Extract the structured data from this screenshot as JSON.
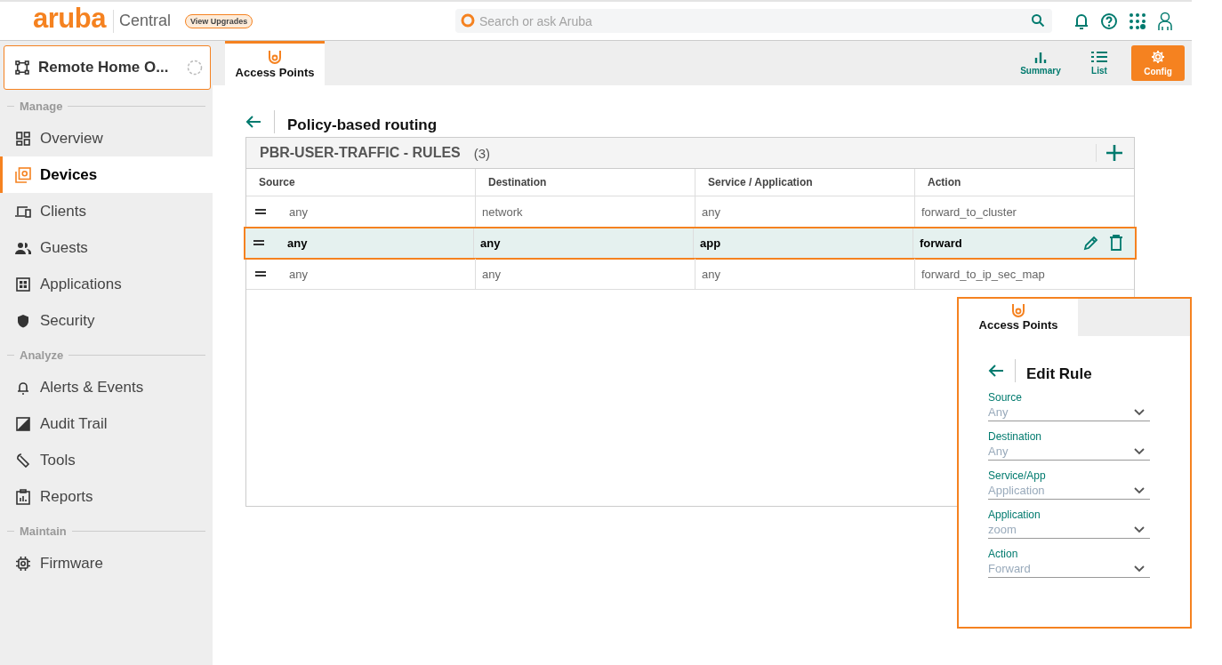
{
  "header": {
    "logo": "aruba",
    "product": "Central",
    "upgrade_badge": "View Upgrades",
    "search": {
      "placeholder": "Search or ask Aruba"
    }
  },
  "site_selector": {
    "label": "Remote Home O..."
  },
  "sidebar": [
    {
      "heading": "Manage",
      "items": [
        {
          "label": "Overview",
          "selected": false
        },
        {
          "label": "Devices",
          "selected": true
        },
        {
          "label": "Clients",
          "selected": false
        },
        {
          "label": "Guests",
          "selected": false
        },
        {
          "label": "Applications",
          "selected": false
        },
        {
          "label": "Security",
          "selected": false
        }
      ]
    },
    {
      "heading": "Analyze",
      "items": [
        {
          "label": "Alerts & Events",
          "selected": false
        },
        {
          "label": "Audit Trail",
          "selected": false
        },
        {
          "label": "Tools",
          "selected": false
        },
        {
          "label": "Reports",
          "selected": false
        }
      ]
    },
    {
      "heading": "Maintain",
      "items": [
        {
          "label": "Firmware",
          "selected": false
        }
      ]
    }
  ],
  "tabs": [
    {
      "label": "Access Points",
      "selected": true
    }
  ],
  "view_buttons": [
    {
      "label": "Summary",
      "selected": false
    },
    {
      "label": "List",
      "selected": false
    },
    {
      "label": "Config",
      "selected": true
    }
  ],
  "page": {
    "title": "Policy-based routing"
  },
  "table": {
    "title": "PBR-USER-TRAFFIC - RULES",
    "count": "(3)",
    "columns": [
      "Source",
      "Destination",
      "Service / Application",
      "Action"
    ],
    "rows": [
      {
        "cells": [
          "any",
          "network",
          "any",
          "forward_to_cluster"
        ],
        "selected": false
      },
      {
        "cells": [
          "any",
          "any",
          "app",
          "forward"
        ],
        "selected": true
      },
      {
        "cells": [
          "any",
          "any",
          "any",
          "forward_to_ip_sec_map"
        ],
        "selected": false
      }
    ]
  },
  "edit_panel": {
    "tab": "Access Points",
    "title": "Edit Rule",
    "fields": [
      {
        "label": "Source",
        "value": "Any"
      },
      {
        "label": "Destination",
        "value": "Any"
      },
      {
        "label": "Service/App",
        "value": "Application"
      },
      {
        "label": "Application",
        "value": "zoom"
      },
      {
        "label": "Action",
        "value": "Forward"
      }
    ]
  }
}
